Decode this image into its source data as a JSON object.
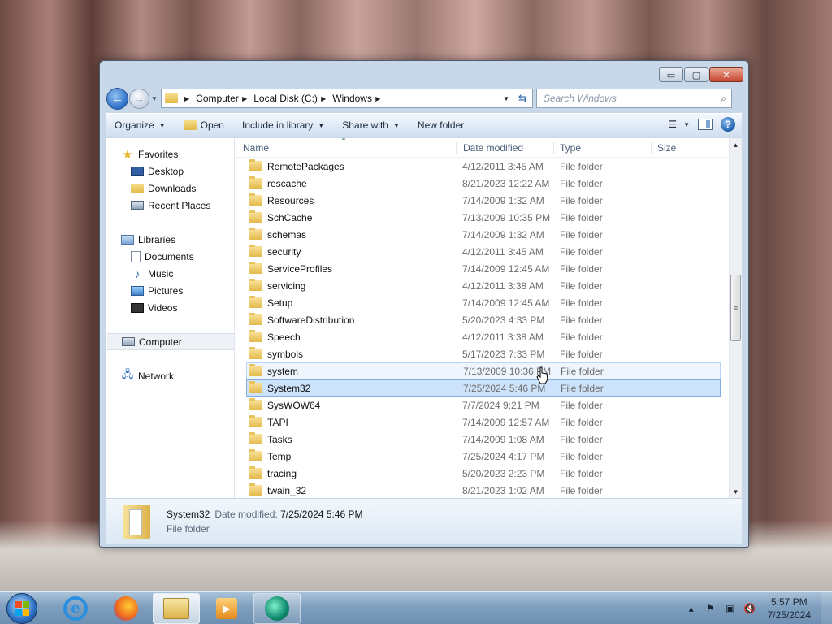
{
  "window": {
    "caption": {
      "minimize": "▭",
      "maximize": "▢",
      "close": "✕"
    }
  },
  "address": {
    "crumbs": [
      "Computer",
      "Local Disk (C:)",
      "Windows"
    ],
    "search_placeholder": "Search Windows"
  },
  "toolbar": {
    "organize": "Organize",
    "open": "Open",
    "include_in_library": "Include in library",
    "share_with": "Share with",
    "new_folder": "New folder"
  },
  "nav": {
    "favorites": "Favorites",
    "desktop": "Desktop",
    "downloads": "Downloads",
    "recent_places": "Recent Places",
    "libraries": "Libraries",
    "documents": "Documents",
    "music": "Music",
    "pictures": "Pictures",
    "videos": "Videos",
    "computer": "Computer",
    "network": "Network"
  },
  "columns": {
    "name": "Name",
    "date_modified": "Date modified",
    "type": "Type",
    "size": "Size"
  },
  "files": [
    {
      "name": "RemotePackages",
      "date": "4/12/2011 3:45 AM",
      "type": "File folder"
    },
    {
      "name": "rescache",
      "date": "8/21/2023 12:22 AM",
      "type": "File folder"
    },
    {
      "name": "Resources",
      "date": "7/14/2009 1:32 AM",
      "type": "File folder"
    },
    {
      "name": "SchCache",
      "date": "7/13/2009 10:35 PM",
      "type": "File folder"
    },
    {
      "name": "schemas",
      "date": "7/14/2009 1:32 AM",
      "type": "File folder"
    },
    {
      "name": "security",
      "date": "4/12/2011 3:45 AM",
      "type": "File folder"
    },
    {
      "name": "ServiceProfiles",
      "date": "7/14/2009 12:45 AM",
      "type": "File folder"
    },
    {
      "name": "servicing",
      "date": "4/12/2011 3:38 AM",
      "type": "File folder"
    },
    {
      "name": "Setup",
      "date": "7/14/2009 12:45 AM",
      "type": "File folder"
    },
    {
      "name": "SoftwareDistribution",
      "date": "5/20/2023 4:33 PM",
      "type": "File folder"
    },
    {
      "name": "Speech",
      "date": "4/12/2011 3:38 AM",
      "type": "File folder"
    },
    {
      "name": "symbols",
      "date": "5/17/2023 7:33 PM",
      "type": "File folder"
    },
    {
      "name": "system",
      "date": "7/13/2009 10:36 PM",
      "type": "File folder",
      "state": "hover"
    },
    {
      "name": "System32",
      "date": "7/25/2024 5:46 PM",
      "type": "File folder",
      "state": "selected"
    },
    {
      "name": "SysWOW64",
      "date": "7/7/2024 9:21 PM",
      "type": "File folder"
    },
    {
      "name": "TAPI",
      "date": "7/14/2009 12:57 AM",
      "type": "File folder"
    },
    {
      "name": "Tasks",
      "date": "7/14/2009 1:08 AM",
      "type": "File folder"
    },
    {
      "name": "Temp",
      "date": "7/25/2024 4:17 PM",
      "type": "File folder"
    },
    {
      "name": "tracing",
      "date": "5/20/2023 2:23 PM",
      "type": "File folder"
    },
    {
      "name": "twain_32",
      "date": "8/21/2023 1:02 AM",
      "type": "File folder"
    }
  ],
  "details": {
    "name": "System32",
    "date_label": "Date modified:",
    "date_value": "7/25/2024 5:46 PM",
    "type": "File folder"
  },
  "taskbar": {
    "clock_time": "5:57 PM",
    "clock_date": "7/25/2024"
  }
}
